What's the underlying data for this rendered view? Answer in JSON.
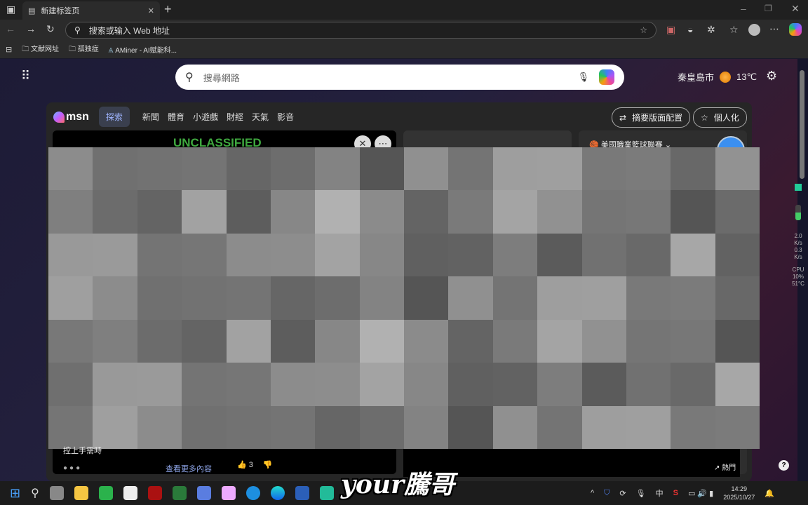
{
  "browser": {
    "tab_title": "新建标签页",
    "address_placeholder": "搜索或输入 Web 地址",
    "bookmarks": [
      "文献网址",
      "孤独症",
      "AMiner - AI赋能科..."
    ]
  },
  "newtab": {
    "search_placeholder": "搜尋網路",
    "city": "秦皇島市",
    "temperature": "13℃"
  },
  "msn": {
    "logo": "msn",
    "nav": [
      "探索",
      "新聞",
      "體育",
      "小遊戲",
      "財經",
      "天氣",
      "影音"
    ],
    "layout_button": "摘要版面配置",
    "personalize_button": "個人化",
    "card1_banner": "UNCLASSIFIED",
    "card1_caption": "控上手需時",
    "see_more": "查看更多內容",
    "likes": "3",
    "sports_title": "美國職業籃球聯賽",
    "trending": "熱門"
  },
  "sidebar_monitor": {
    "up": "2.0",
    "down": "0.3",
    "unit": "K/s",
    "cpu_label": "CPU",
    "cpu": "10%",
    "temp": "51°C"
  },
  "taskbar": {
    "ime": "中",
    "time": "14:29",
    "date": "2025/10/27"
  },
  "subtitle": "your騰哥"
}
